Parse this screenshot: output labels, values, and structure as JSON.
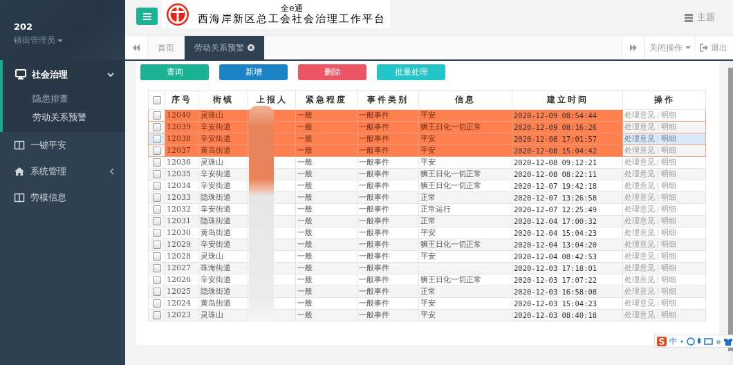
{
  "sidebar": {
    "user": {
      "name": "202",
      "role": "镇街管理员"
    },
    "menu": [
      {
        "label": "社会治理",
        "expanded": true,
        "children": [
          {
            "label": "隐患排查",
            "selected": false
          },
          {
            "label": "劳动关系预警",
            "selected": true
          }
        ]
      },
      {
        "label": "一键平安",
        "expanded": false
      },
      {
        "label": "系统管理",
        "expanded": false,
        "has_children": true
      },
      {
        "label": "劳模信息",
        "expanded": false
      }
    ]
  },
  "header": {
    "logo": {
      "top_line": "全e通",
      "bottom_line": "西海岸新区总工会社会治理工作平台"
    },
    "theme_label": "主题"
  },
  "tab_bar": {
    "tabs": [
      {
        "label": "首页",
        "selected": false,
        "closable": false
      },
      {
        "label": "劳动关系预警",
        "selected": true,
        "closable": true
      }
    ],
    "close_menu": "关闭操作",
    "logout": "退出"
  },
  "toolbar": {
    "buttons": [
      {
        "label": "查询",
        "color": "#1ab394"
      },
      {
        "label": "新增",
        "color": "#1c84c6"
      },
      {
        "label": "删除",
        "color": "#ed5565"
      },
      {
        "label": "批量处理",
        "color": "#23c6c8"
      }
    ]
  },
  "table": {
    "select_all_checked": false,
    "columns": [
      "序号",
      "街镇",
      "上报人",
      "紧急程度",
      "事件类别",
      "信息",
      "建立时间",
      "操作"
    ],
    "rows": [
      {
        "checked": false,
        "alert": true,
        "hovered": false,
        "id": "12040",
        "town": "灵珠山",
        "urgency": "一般",
        "category": "一般事件",
        "info": "平安",
        "time": "2020-12-09 08:54:44",
        "actions": [
          "处理意见",
          "明细"
        ]
      },
      {
        "checked": false,
        "alert": true,
        "hovered": false,
        "id": "12039",
        "town": "辛安街道",
        "urgency": "一般",
        "category": "一般事件",
        "info": "狮王日化一切正常",
        "time": "2020-12-09 08:16:26",
        "actions": [
          "处理意见",
          "明细"
        ]
      },
      {
        "checked": false,
        "alert": true,
        "hovered": true,
        "id": "12038",
        "town": "辛安街道",
        "urgency": "一般",
        "category": "一般事件",
        "info": "平安",
        "time": "2020-12-08 17:01:57",
        "actions": [
          "处理意见",
          "明细"
        ]
      },
      {
        "checked": false,
        "alert": true,
        "hovered": false,
        "id": "12037",
        "town": "黄岛街道",
        "urgency": "一般",
        "category": "一般事件",
        "info": "平安",
        "time": "2020-12-08 15:04:42",
        "actions": [
          "处理意见",
          "明细"
        ]
      },
      {
        "checked": false,
        "alert": false,
        "hovered": false,
        "id": "12036",
        "town": "灵珠山",
        "urgency": "一般",
        "category": "一般事件",
        "info": "平安",
        "time": "2020-12-08 09:12:21",
        "actions": [
          "处理意见",
          "明细"
        ]
      },
      {
        "checked": false,
        "alert": false,
        "hovered": false,
        "id": "12035",
        "town": "辛安街道",
        "urgency": "一般",
        "category": "一般事件",
        "info": "狮王日化一切正常",
        "time": "2020-12-08 08:22:11",
        "actions": [
          "处理意见",
          "明细"
        ]
      },
      {
        "checked": false,
        "alert": false,
        "hovered": false,
        "id": "12034",
        "town": "辛安街道",
        "urgency": "一般",
        "category": "一般事件",
        "info": "狮王日化一切正常",
        "time": "2020-12-07 19:42:18",
        "actions": [
          "处理意见",
          "明细"
        ]
      },
      {
        "checked": false,
        "alert": false,
        "hovered": false,
        "id": "12033",
        "town": "隐珠街道",
        "urgency": "一般",
        "category": "一般事件",
        "info": "正常",
        "time": "2020-12-07 13:26:58",
        "actions": [
          "处理意见",
          "明细"
        ]
      },
      {
        "checked": false,
        "alert": false,
        "hovered": false,
        "id": "12032",
        "town": "辛安街道",
        "urgency": "一般",
        "category": "一般事件",
        "info": "正常运行",
        "time": "2020-12-07 12:25:49",
        "actions": [
          "处理意见",
          "明细"
        ]
      },
      {
        "checked": false,
        "alert": false,
        "hovered": false,
        "id": "12031",
        "town": "隐珠街道",
        "urgency": "一般",
        "category": "一般事件",
        "info": "正常",
        "time": "2020-12-04 17:00:32",
        "actions": [
          "处理意见",
          "明细"
        ]
      },
      {
        "checked": false,
        "alert": false,
        "hovered": false,
        "id": "12030",
        "town": "黄岛街道",
        "urgency": "一般",
        "category": "一般事件",
        "info": "平安",
        "time": "2020-12-04 15:04:23",
        "actions": [
          "处理意见",
          "明细"
        ]
      },
      {
        "checked": false,
        "alert": false,
        "hovered": false,
        "id": "12029",
        "town": "辛安街道",
        "urgency": "一般",
        "category": "一般事件",
        "info": "狮王日化一切正常",
        "time": "2020-12-04 13:04:20",
        "actions": [
          "处理意见",
          "明细"
        ]
      },
      {
        "checked": false,
        "alert": false,
        "hovered": false,
        "id": "12028",
        "town": "灵珠山",
        "urgency": "一般",
        "category": "一般事件",
        "info": "平安",
        "time": "2020-12-04 08:42:53",
        "actions": [
          "处理意见",
          "明细"
        ]
      },
      {
        "checked": false,
        "alert": false,
        "hovered": false,
        "id": "12027",
        "town": "珠海街道",
        "urgency": "一般",
        "category": "一般事件",
        "time": "2020-12-03 17:18:01",
        "actions": [
          "处理意见",
          "明细"
        ]
      },
      {
        "checked": false,
        "alert": false,
        "hovered": false,
        "id": "12026",
        "town": "辛安街道",
        "urgency": "一般",
        "category": "一般事件",
        "info": "狮王日化一切正常",
        "time": "2020-12-03 17:07:22",
        "actions": [
          "处理意见",
          "明细"
        ]
      },
      {
        "checked": false,
        "alert": false,
        "hovered": false,
        "id": "12025",
        "town": "隐珠街道",
        "urgency": "一般",
        "category": "一般事件",
        "info": "正常",
        "time": "2020-12-03 16:58:08",
        "actions": [
          "处理意见",
          "明细"
        ]
      },
      {
        "checked": false,
        "alert": false,
        "hovered": false,
        "id": "12024",
        "town": "黄岛街道",
        "urgency": "一般",
        "category": "一般事件",
        "info": "平安",
        "time": "2020-12-03 15:04:23",
        "actions": [
          "处理意见",
          "明细"
        ]
      },
      {
        "checked": false,
        "alert": false,
        "hovered": false,
        "id": "12023",
        "town": "灵珠山",
        "urgency": "一般",
        "category": "一般事件",
        "info": "平安",
        "time": "2020-12-03 08:40:18",
        "actions": [
          "处理意见",
          "明细"
        ]
      }
    ]
  },
  "ime_toolbar": {
    "mode": "中"
  }
}
